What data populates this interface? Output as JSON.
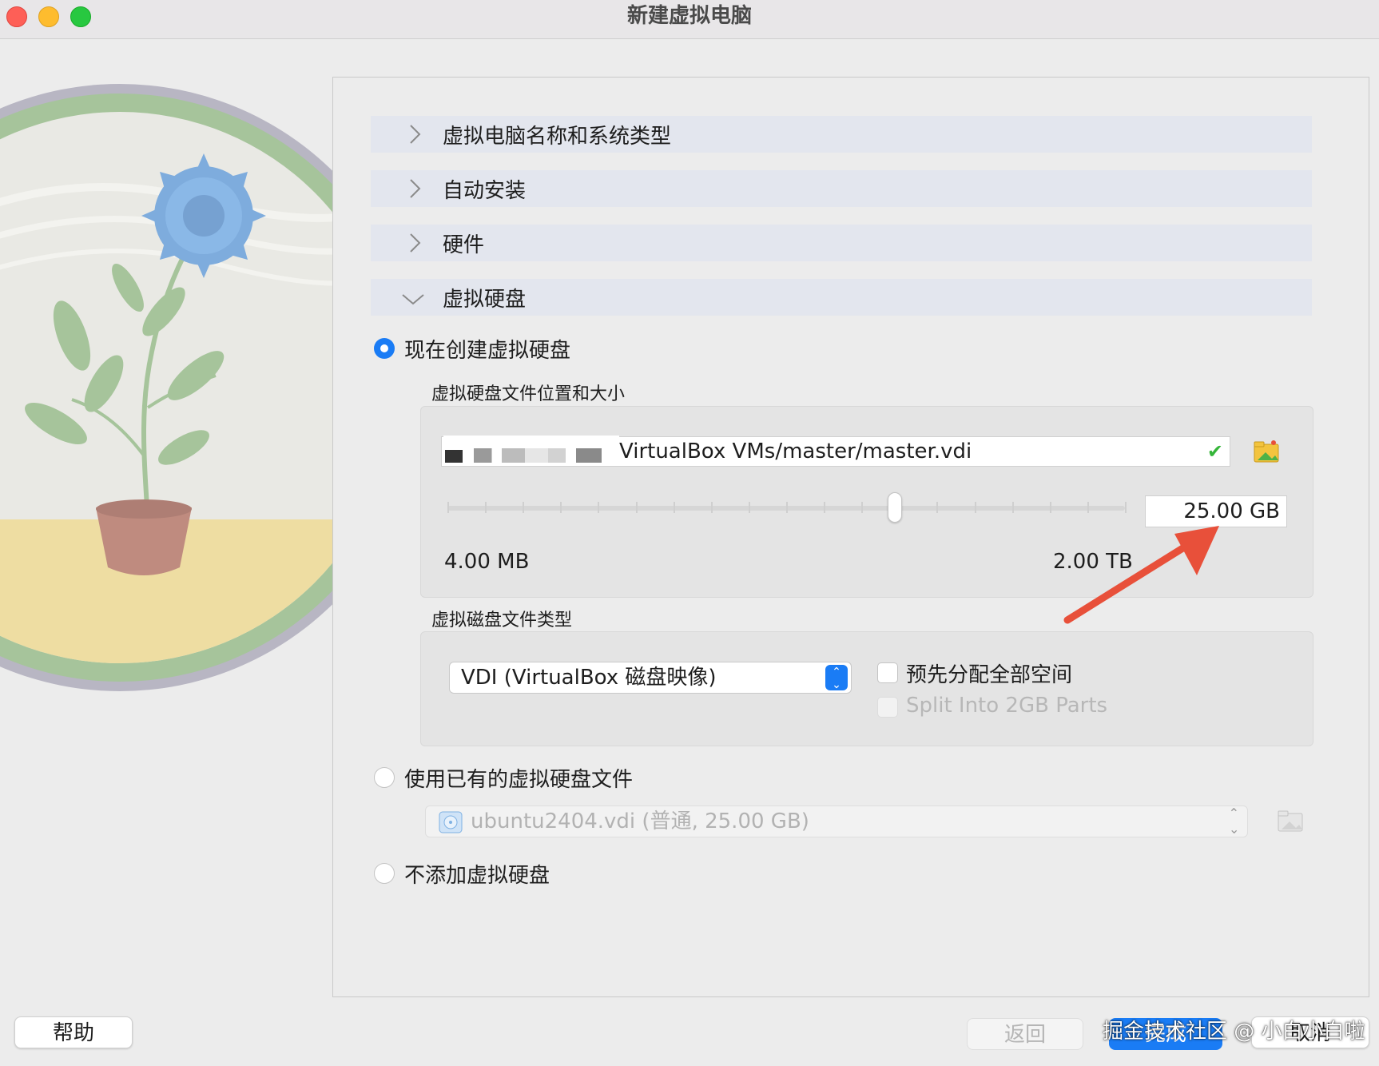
{
  "window": {
    "title": "新建虚拟电脑"
  },
  "sections": [
    {
      "label": "虚拟电脑名称和系统类型",
      "expanded": false
    },
    {
      "label": "自动安装",
      "expanded": false
    },
    {
      "label": "硬件",
      "expanded": false
    },
    {
      "label": "虚拟硬盘",
      "expanded": true
    }
  ],
  "disk": {
    "option_create": "现在创建虚拟硬盘",
    "location_size_label": "虚拟硬盘文件位置和大小",
    "path_visible": "VirtualBox VMs/master/master.vdi",
    "path_status": "valid",
    "size_value": "25.00 GB",
    "size_fraction": 0.66,
    "size_min": "4.00 MB",
    "size_max": "2.00 TB",
    "file_type_label": "虚拟磁盘文件类型",
    "file_type_selected": "VDI (VirtualBox 磁盘映像)",
    "preallocate_label": "预先分配全部空间",
    "preallocate_checked": false,
    "split_label": "Split Into 2GB Parts",
    "split_checked": false,
    "option_existing": "使用已有的虚拟硬盘文件",
    "existing_selected": "ubuntu2404.vdi (普通, 25.00 GB)",
    "option_none": "不添加虚拟硬盘"
  },
  "buttons": {
    "help": "帮助",
    "back": "返回",
    "finish": "完成",
    "cancel": "取消"
  },
  "watermark": "掘金技术社区 @ 小白小白啦",
  "colors": {
    "accent": "#1a7cf5",
    "section_bg": "#e3e6ee",
    "annotation_arrow": "#e8503a"
  }
}
